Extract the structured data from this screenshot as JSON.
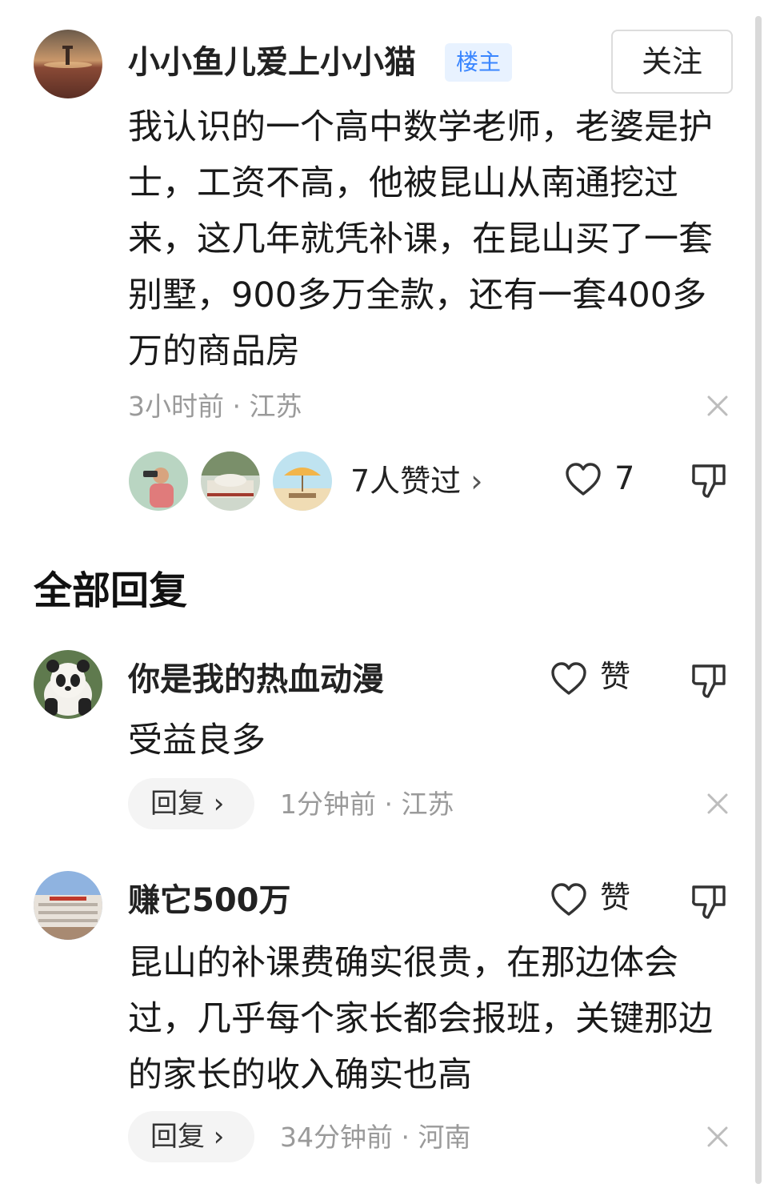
{
  "post": {
    "author": "小小鱼儿爱上小小猫",
    "badge": "楼主",
    "follow_label": "关注",
    "body": "我认识的一个高中数学老师，老婆是护士，工资不高，他被昆山从南通挖过来，这几年就凭补课，在昆山买了一套别墅，900多万全款，还有一套400多万的商品房",
    "meta": "3小时前 · 江苏",
    "likers_label": "7人赞过",
    "like_count": "7"
  },
  "section_title": "全部回复",
  "replies": [
    {
      "author": "你是我的热血动漫",
      "text": "受益良多",
      "like_label": "赞",
      "reply_label": "回复",
      "meta": "1分钟前 · 江苏"
    },
    {
      "author": "赚它500万",
      "text": "昆山的补课费确实很贵，在那边体会过，几乎每个家长都会报班，关键那边的家长的收入确实也高",
      "like_label": "赞",
      "reply_label": "回复",
      "meta": "34分钟前 · 河南"
    }
  ],
  "icons": [
    "heart-icon",
    "thumb-down-icon",
    "close-icon",
    "chevron-right-icon"
  ],
  "colors": {
    "badge_bg": "#e8f2ff",
    "badge_text": "#3a86ff",
    "meta_gray": "#9a9a9a"
  }
}
